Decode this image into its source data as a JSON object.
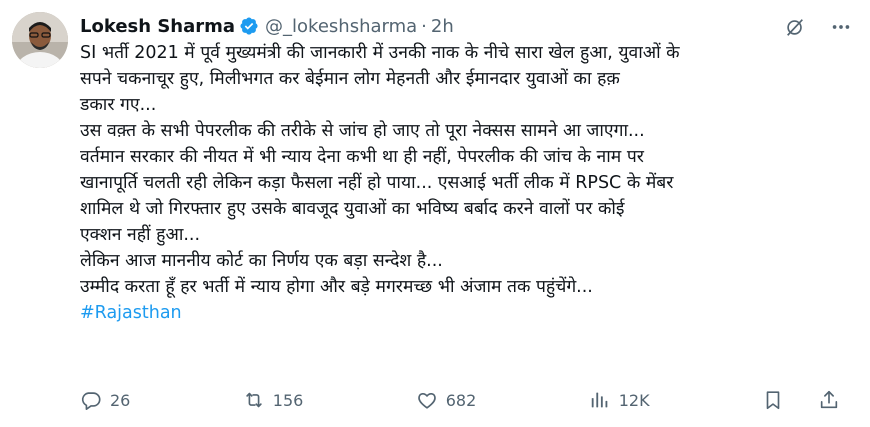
{
  "author": {
    "name": "Lokesh Sharma",
    "handle": "@_lokeshsharma",
    "separator": "·",
    "time": "2h",
    "verified_color": "#1d9bf0"
  },
  "tweet": {
    "lines": [
      "SI भर्ती 2021 में पूर्व मुख्यमंत्री की जानकारी में उनकी नाक के नीचे सारा खेल हुआ, युवाओं के",
      "सपने चकनाचूर हुए, मिलीभगत कर बेईमान लोग मेहनती और ईमानदार युवाओं का हक़",
      "डकार गए...",
      "उस वक़्त के सभी पेपरलीक की तरीके से जांच हो जाए तो पूरा नेक्सस सामने आ जाएगा...",
      "वर्तमान सरकार की नीयत में भी न्याय देना कभी था ही नहीं, पेपरलीक की जांच के नाम पर",
      "खानापूर्ति चलती रही लेकिन कड़ा फैसला नहीं हो पाया... एसआई भर्ती लीक में RPSC के मेंबर",
      "शामिल थे जो गिरफ्तार हुए उसके बावजूद युवाओं का भविष्य बर्बाद करने वालों पर कोई",
      "एक्शन नहीं हुआ...",
      "लेकिन आज माननीय कोर्ट का निर्णय एक बड़ा सन्देश है...",
      "उम्मीद करता हूँ हर भर्ती में न्याय होगा और बड़े मगरमच्छ भी अंजाम तक पहुंचेंगे..."
    ],
    "hashtag": "#Rajasthan"
  },
  "metrics": {
    "replies": "26",
    "reposts": "156",
    "likes": "682",
    "views": "12K"
  },
  "icons": {
    "grok": "grok-icon",
    "more": "more-icon",
    "reply": "reply-icon",
    "repost": "repost-icon",
    "like": "like-icon",
    "views": "views-icon",
    "bookmark": "bookmark-icon",
    "share": "share-icon"
  },
  "colors": {
    "text": "#0f1419",
    "muted": "#536471",
    "accent": "#1d9bf0"
  }
}
